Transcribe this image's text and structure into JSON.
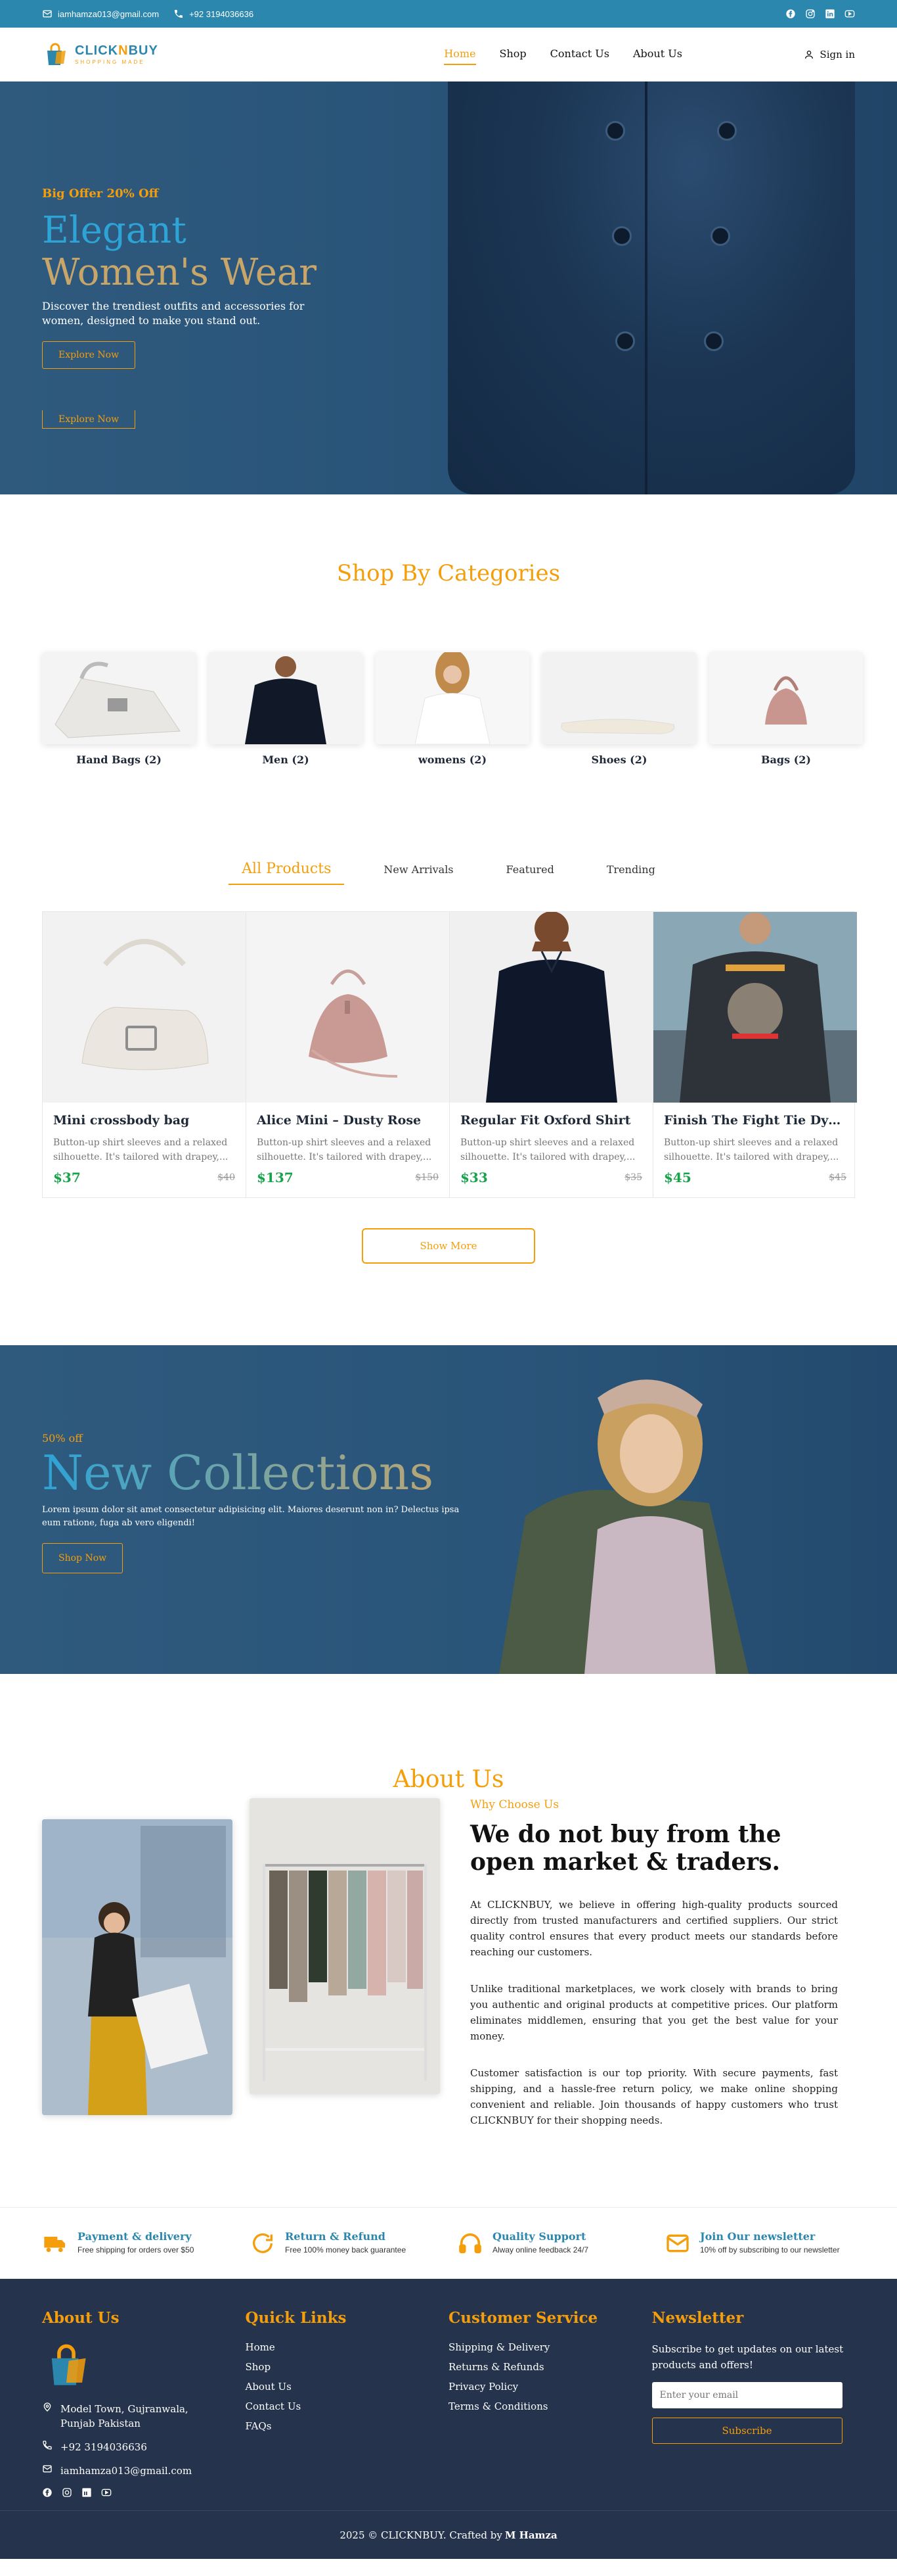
{
  "topbar": {
    "email": "iamhamza013@gmail.com",
    "phone": "+92 3194036636",
    "social_icons": [
      "facebook-icon",
      "instagram-icon",
      "linkedin-icon",
      "youtube-icon"
    ]
  },
  "header": {
    "logo_title_a": "CLICK",
    "logo_title_n": "N",
    "logo_title_b": "BUY",
    "logo_sub": "SHOPPING MADE",
    "nav": [
      "Home",
      "Shop",
      "Contact Us",
      "About Us"
    ],
    "signin": "Sign in"
  },
  "hero": {
    "offer": "Big Offer 20% Off",
    "title_line1": "Elegant",
    "title_line2": "Women's Wear",
    "subtitle": "Discover the trendiest outfits and accessories for women, designed to make you stand out.",
    "cta": "Explore Now",
    "ghost_cta": "Explore Now"
  },
  "categories": {
    "title": "Shop By Categories",
    "items": [
      {
        "label": "Hand Bags (2)"
      },
      {
        "label": "Men (2)"
      },
      {
        "label": "womens (2)"
      },
      {
        "label": "Shoes (2)"
      },
      {
        "label": "Bags (2)"
      }
    ]
  },
  "products": {
    "tabs": [
      "All Products",
      "New Arrivals",
      "Featured",
      "Trending"
    ],
    "items": [
      {
        "name": "Mini crossbody bag",
        "desc": "Button-up shirt sleeves and a relaxed silhouette. It's tailored with drapey,...",
        "price": "$37",
        "old": "$40"
      },
      {
        "name": "Alice Mini – Dusty Rose",
        "desc": "Button-up shirt sleeves and a relaxed silhouette. It's tailored with drapey,...",
        "price": "$137",
        "old": "$150"
      },
      {
        "name": "Regular Fit Oxford Shirt",
        "desc": "Button-up shirt sleeves and a relaxed silhouette. It's tailored with drapey,...",
        "price": "$33",
        "old": "$35"
      },
      {
        "name": "Finish The Fight Tie Dye Sw...",
        "desc": "Button-up shirt sleeves and a relaxed silhouette. It's tailored with drapey,...",
        "price": "$45",
        "old": "$45"
      }
    ],
    "show_more": "Show More"
  },
  "collections": {
    "pct": "50% off",
    "title": "New Collections",
    "text": "Lorem ipsum dolor sit amet consectetur adipisicing elit. Maiores deserunt non in? Delectus ipsa eum ratione, fuga ab vero eligendi!",
    "cta": "Shop Now"
  },
  "about": {
    "title": "About Us",
    "why": "Why Choose Us",
    "heading": "We do not buy from the open market & traders.",
    "p1": "At CLICKNBUY, we believe in offering high-quality products sourced directly from trusted manufacturers and certified suppliers. Our strict quality control ensures that every product meets our standards before reaching our customers.",
    "p2": "Unlike traditional marketplaces, we work closely with brands to bring you authentic and original products at competitive prices. Our platform eliminates middlemen, ensuring that you get the best value for your money.",
    "p3": "Customer satisfaction is our top priority. With secure payments, fast shipping, and a hassle-free return policy, we make online shopping convenient and reliable. Join thousands of happy customers who trust CLICKNBUY for their shopping needs."
  },
  "features": [
    {
      "icon": "truck-icon",
      "title": "Payment & delivery",
      "sub": "Free shipping for orders over $50"
    },
    {
      "icon": "refresh-icon",
      "title": "Return & Refund",
      "sub": "Free 100% money back guarantee"
    },
    {
      "icon": "headphones-icon",
      "title": "Quality Support",
      "sub": "Alway online feedback 24/7"
    },
    {
      "icon": "mail-icon",
      "title": "Join Our newsletter",
      "sub": "10% off by subscribing to our newsletter"
    }
  ],
  "footer": {
    "about_title": "About Us",
    "address": "Model Town, Gujranwala, Punjab Pakistan",
    "phone": "+92 3194036636",
    "email": "iamhamza013@gmail.com",
    "quick_title": "Quick Links",
    "quick": [
      "Home",
      "Shop",
      "About Us",
      "Contact Us",
      "FAQs"
    ],
    "service_title": "Customer Service",
    "service": [
      "Shipping & Delivery",
      "Returns & Refunds",
      "Privacy Policy",
      "Terms & Conditions"
    ],
    "newsletter_title": "Newsletter",
    "newsletter_text": "Subscribe to get updates on our latest products and offers!",
    "newsletter_placeholder": "Enter your email",
    "subscribe": "Subscribe",
    "copyright_prefix": "2025 © CLICKNBUY. Crafted by ",
    "copyright_author": "M Hamza"
  },
  "colors": {
    "brand_blue": "#2b87ae",
    "accent_orange": "#f59e0b",
    "price_green": "#16a34a",
    "footer_bg": "#25344c"
  }
}
